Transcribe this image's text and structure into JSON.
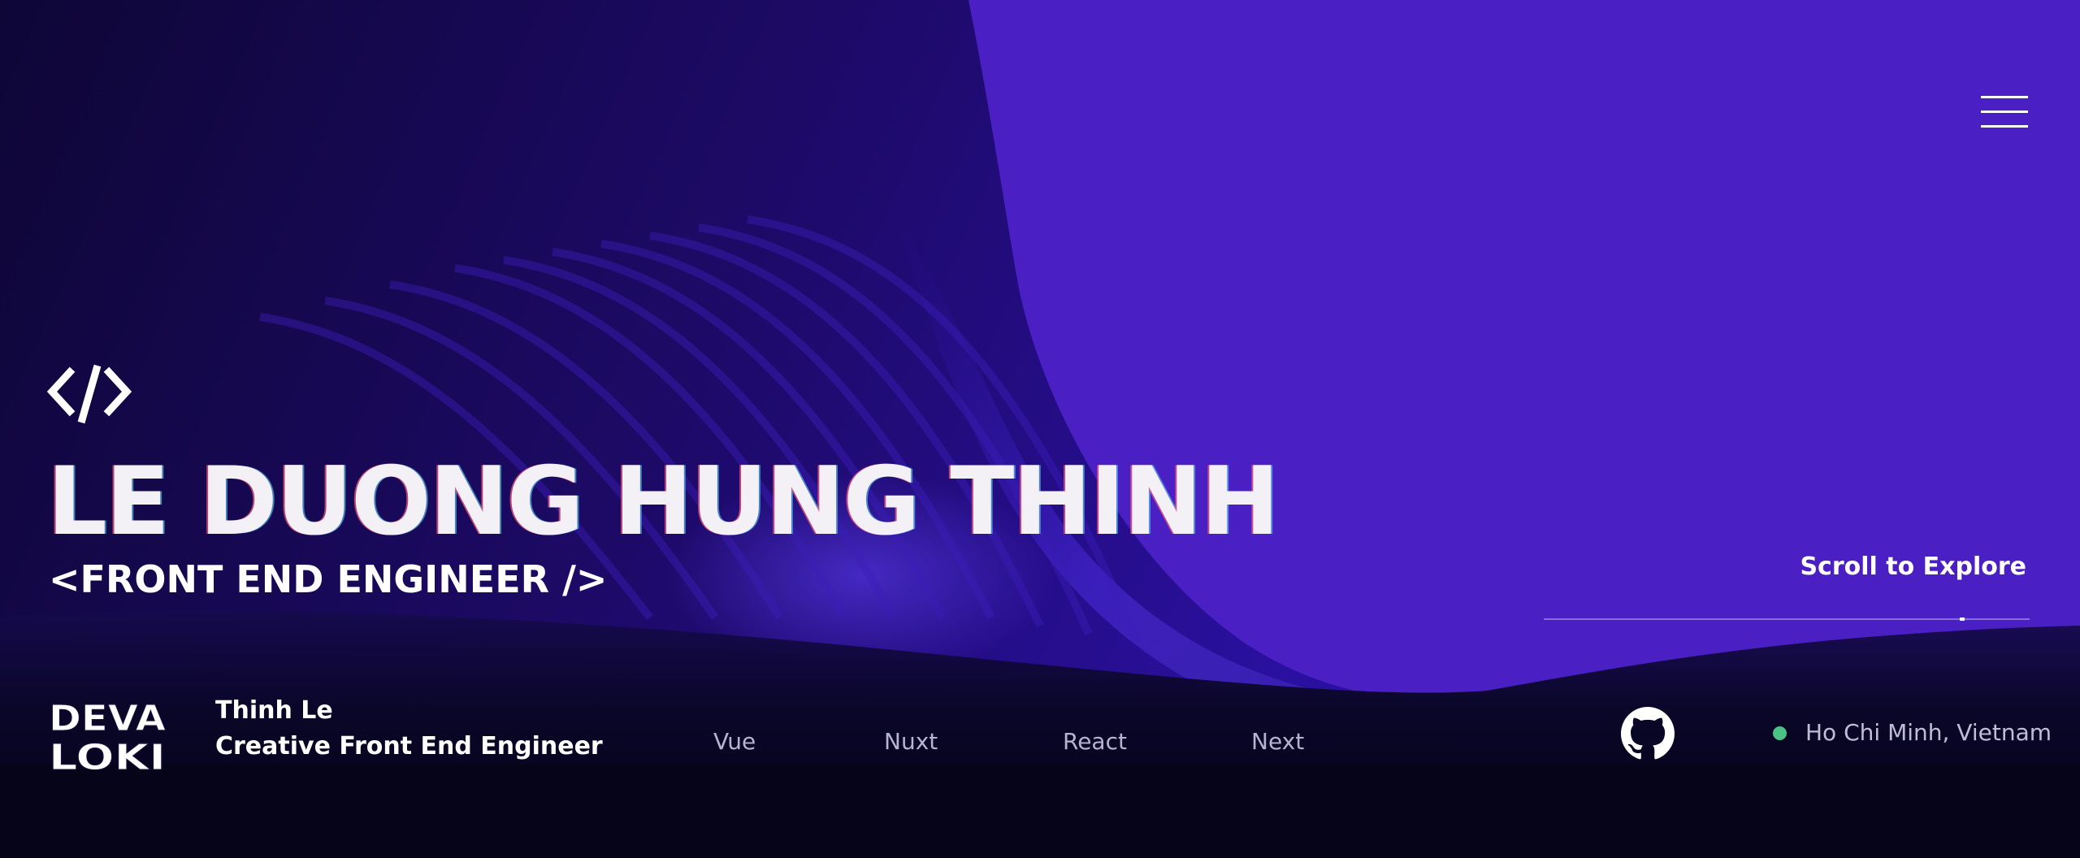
{
  "header": {
    "menu_icon": "hamburger-menu-icon"
  },
  "hero": {
    "code_icon": "code-slash-icon",
    "code_glyph": "</>",
    "title": "LE DUONG HUNG THINH",
    "subtitle": "<FRONT END ENGINEER />",
    "scroll_label": "Scroll to Explore"
  },
  "footer": {
    "logo_lines": [
      "DEVA",
      "LOKI"
    ],
    "name": "Thinh Le",
    "role": "Creative Front End Engineer",
    "tech": [
      "Vue",
      "Nuxt",
      "React",
      "Next"
    ],
    "github_icon": "github-icon",
    "location": "Ho Chi Minh, Vietnam",
    "status_color": "#4ac384"
  },
  "colors": {
    "accent": "#4a1fc4",
    "background_dark": "#08051f",
    "text": "#ffffff"
  }
}
